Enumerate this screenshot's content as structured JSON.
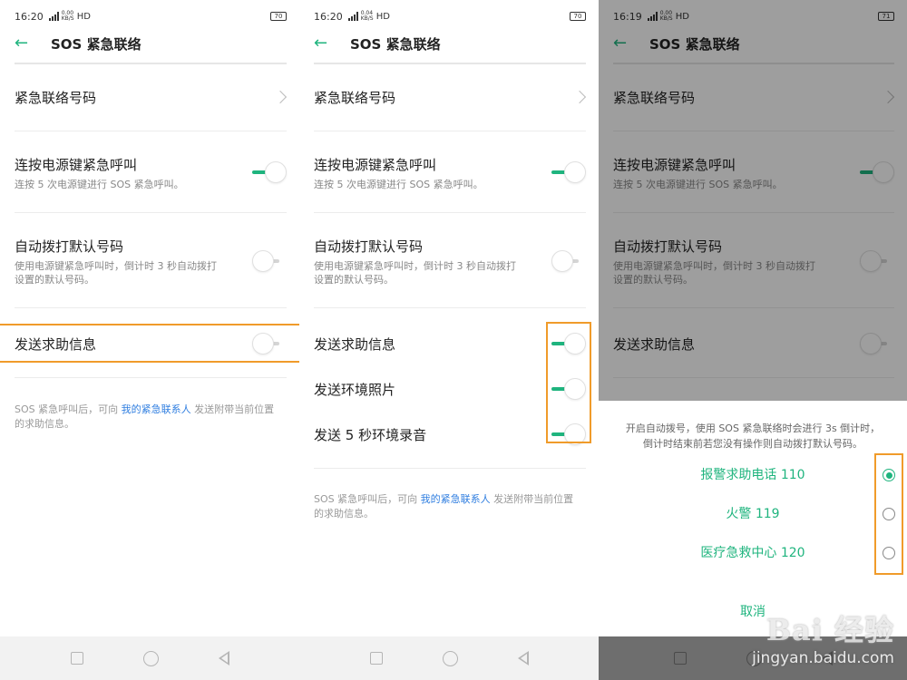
{
  "screens": [
    {
      "status": {
        "time": "16:20",
        "net_top": "0.00",
        "net_bottom": "KB/S",
        "hd": "HD",
        "battery": "70"
      },
      "title": "SOS 紧急联络",
      "rows": {
        "contact": "紧急联络号码",
        "power": {
          "title": "连按电源键紧急呼叫",
          "sub": "连按 5 次电源键进行 SOS 紧急呼叫。",
          "on": true
        },
        "autodial": {
          "title": "自动拨打默认号码",
          "sub1": "使用电源键紧急呼叫时，倒计时 3 秒自动拨打",
          "sub2": "设置的默认号码。",
          "on": false
        },
        "sendinfo": {
          "title": "发送求助信息",
          "on": false
        }
      },
      "footnote": {
        "pre": "SOS 紧急呼叫后，可向 ",
        "link": "我的紧急联系人",
        "post": " 发送附带当前位置",
        "line2": "的求助信息。"
      }
    },
    {
      "status": {
        "time": "16:20",
        "net_top": "0.04",
        "net_bottom": "KB/S",
        "hd": "HD",
        "battery": "70"
      },
      "title": "SOS 紧急联络",
      "rows": {
        "contact": "紧急联络号码",
        "power": {
          "title": "连按电源键紧急呼叫",
          "sub": "连按 5 次电源键进行 SOS 紧急呼叫。",
          "on": true
        },
        "autodial": {
          "title": "自动拨打默认号码",
          "sub1": "使用电源键紧急呼叫时，倒计时 3 秒自动拨打",
          "sub2": "设置的默认号码。",
          "on": false
        },
        "sendinfo": {
          "title": "发送求助信息",
          "on": true
        },
        "photo": {
          "title": "发送环境照片",
          "on": true
        },
        "audio": {
          "title": "发送 5 秒环境录音",
          "on": true
        }
      },
      "footnote": {
        "pre": "SOS 紧急呼叫后，可向 ",
        "link": "我的紧急联系人",
        "post": " 发送附带当前位置",
        "line2": "的求助信息。"
      }
    },
    {
      "status": {
        "time": "16:19",
        "net_top": "0.00",
        "net_bottom": "KB/S",
        "hd": "HD",
        "battery": "71"
      },
      "title": "SOS 紧急联络",
      "rows": {
        "contact": "紧急联络号码",
        "power": {
          "title": "连按电源键紧急呼叫",
          "sub": "连按 5 次电源键进行 SOS 紧急呼叫。",
          "on": true
        },
        "autodial": {
          "title": "自动拨打默认号码",
          "sub1": "使用电源键紧急呼叫时，倒计时 3 秒自动拨打",
          "sub2": "设置的默认号码。",
          "on": false
        },
        "sendinfo": {
          "title": "发送求助信息",
          "on": false
        }
      },
      "dialog": {
        "msg1": "开启自动拨号，使用 SOS 紧急联络时会进行 3s 倒计时，",
        "msg2": "倒计时结束前若您没有操作则自动拨打默认号码。",
        "options": [
          {
            "label": "报警求助电话 110",
            "selected": true
          },
          {
            "label": "火警 119",
            "selected": false
          },
          {
            "label": "医疗急救中心 120",
            "selected": false
          }
        ],
        "cancel": "取消"
      }
    }
  ],
  "watermark": {
    "brand": "Bai 经验",
    "url": "jingyan.baidu.com"
  },
  "colors": {
    "accent": "#1fb47e",
    "highlight": "#f09b2a",
    "link": "#2f7ee0"
  }
}
